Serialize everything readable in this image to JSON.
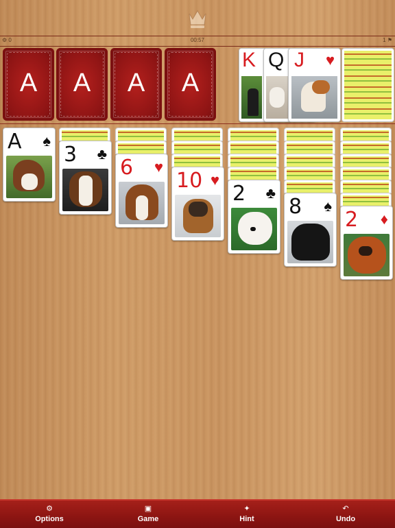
{
  "header": {
    "left_status": "0",
    "timer": "00:57",
    "right_status": "1"
  },
  "foundations": [
    {
      "label": "A"
    },
    {
      "label": "A"
    },
    {
      "label": "A"
    },
    {
      "label": "A"
    }
  ],
  "waste": [
    {
      "rank": "K",
      "suit": "♥",
      "color": "red"
    },
    {
      "rank": "Q",
      "suit": "♥",
      "color": "black"
    },
    {
      "rank": "J",
      "suit": "♥",
      "color": "red"
    }
  ],
  "tableau": [
    {
      "rank": "A",
      "suit": "♠",
      "color": "black"
    },
    {
      "rank": "3",
      "suit": "♣",
      "color": "black"
    },
    {
      "rank": "6",
      "suit": "♥",
      "color": "red"
    },
    {
      "rank": "10",
      "suit": "♥",
      "color": "red"
    },
    {
      "rank": "2",
      "suit": "♣",
      "color": "black"
    },
    {
      "rank": "8",
      "suit": "♠",
      "color": "black"
    },
    {
      "rank": "2",
      "suit": "♦",
      "color": "red"
    }
  ],
  "toolbar": {
    "options": "Options",
    "game": "Game",
    "hint": "Hint",
    "undo": "Undo"
  },
  "icons": {
    "options": "gear-icon",
    "game": "cards-icon",
    "hint": "lightbulb-icon",
    "undo": "undo-arrow-icon",
    "crown": "crown-icon"
  }
}
